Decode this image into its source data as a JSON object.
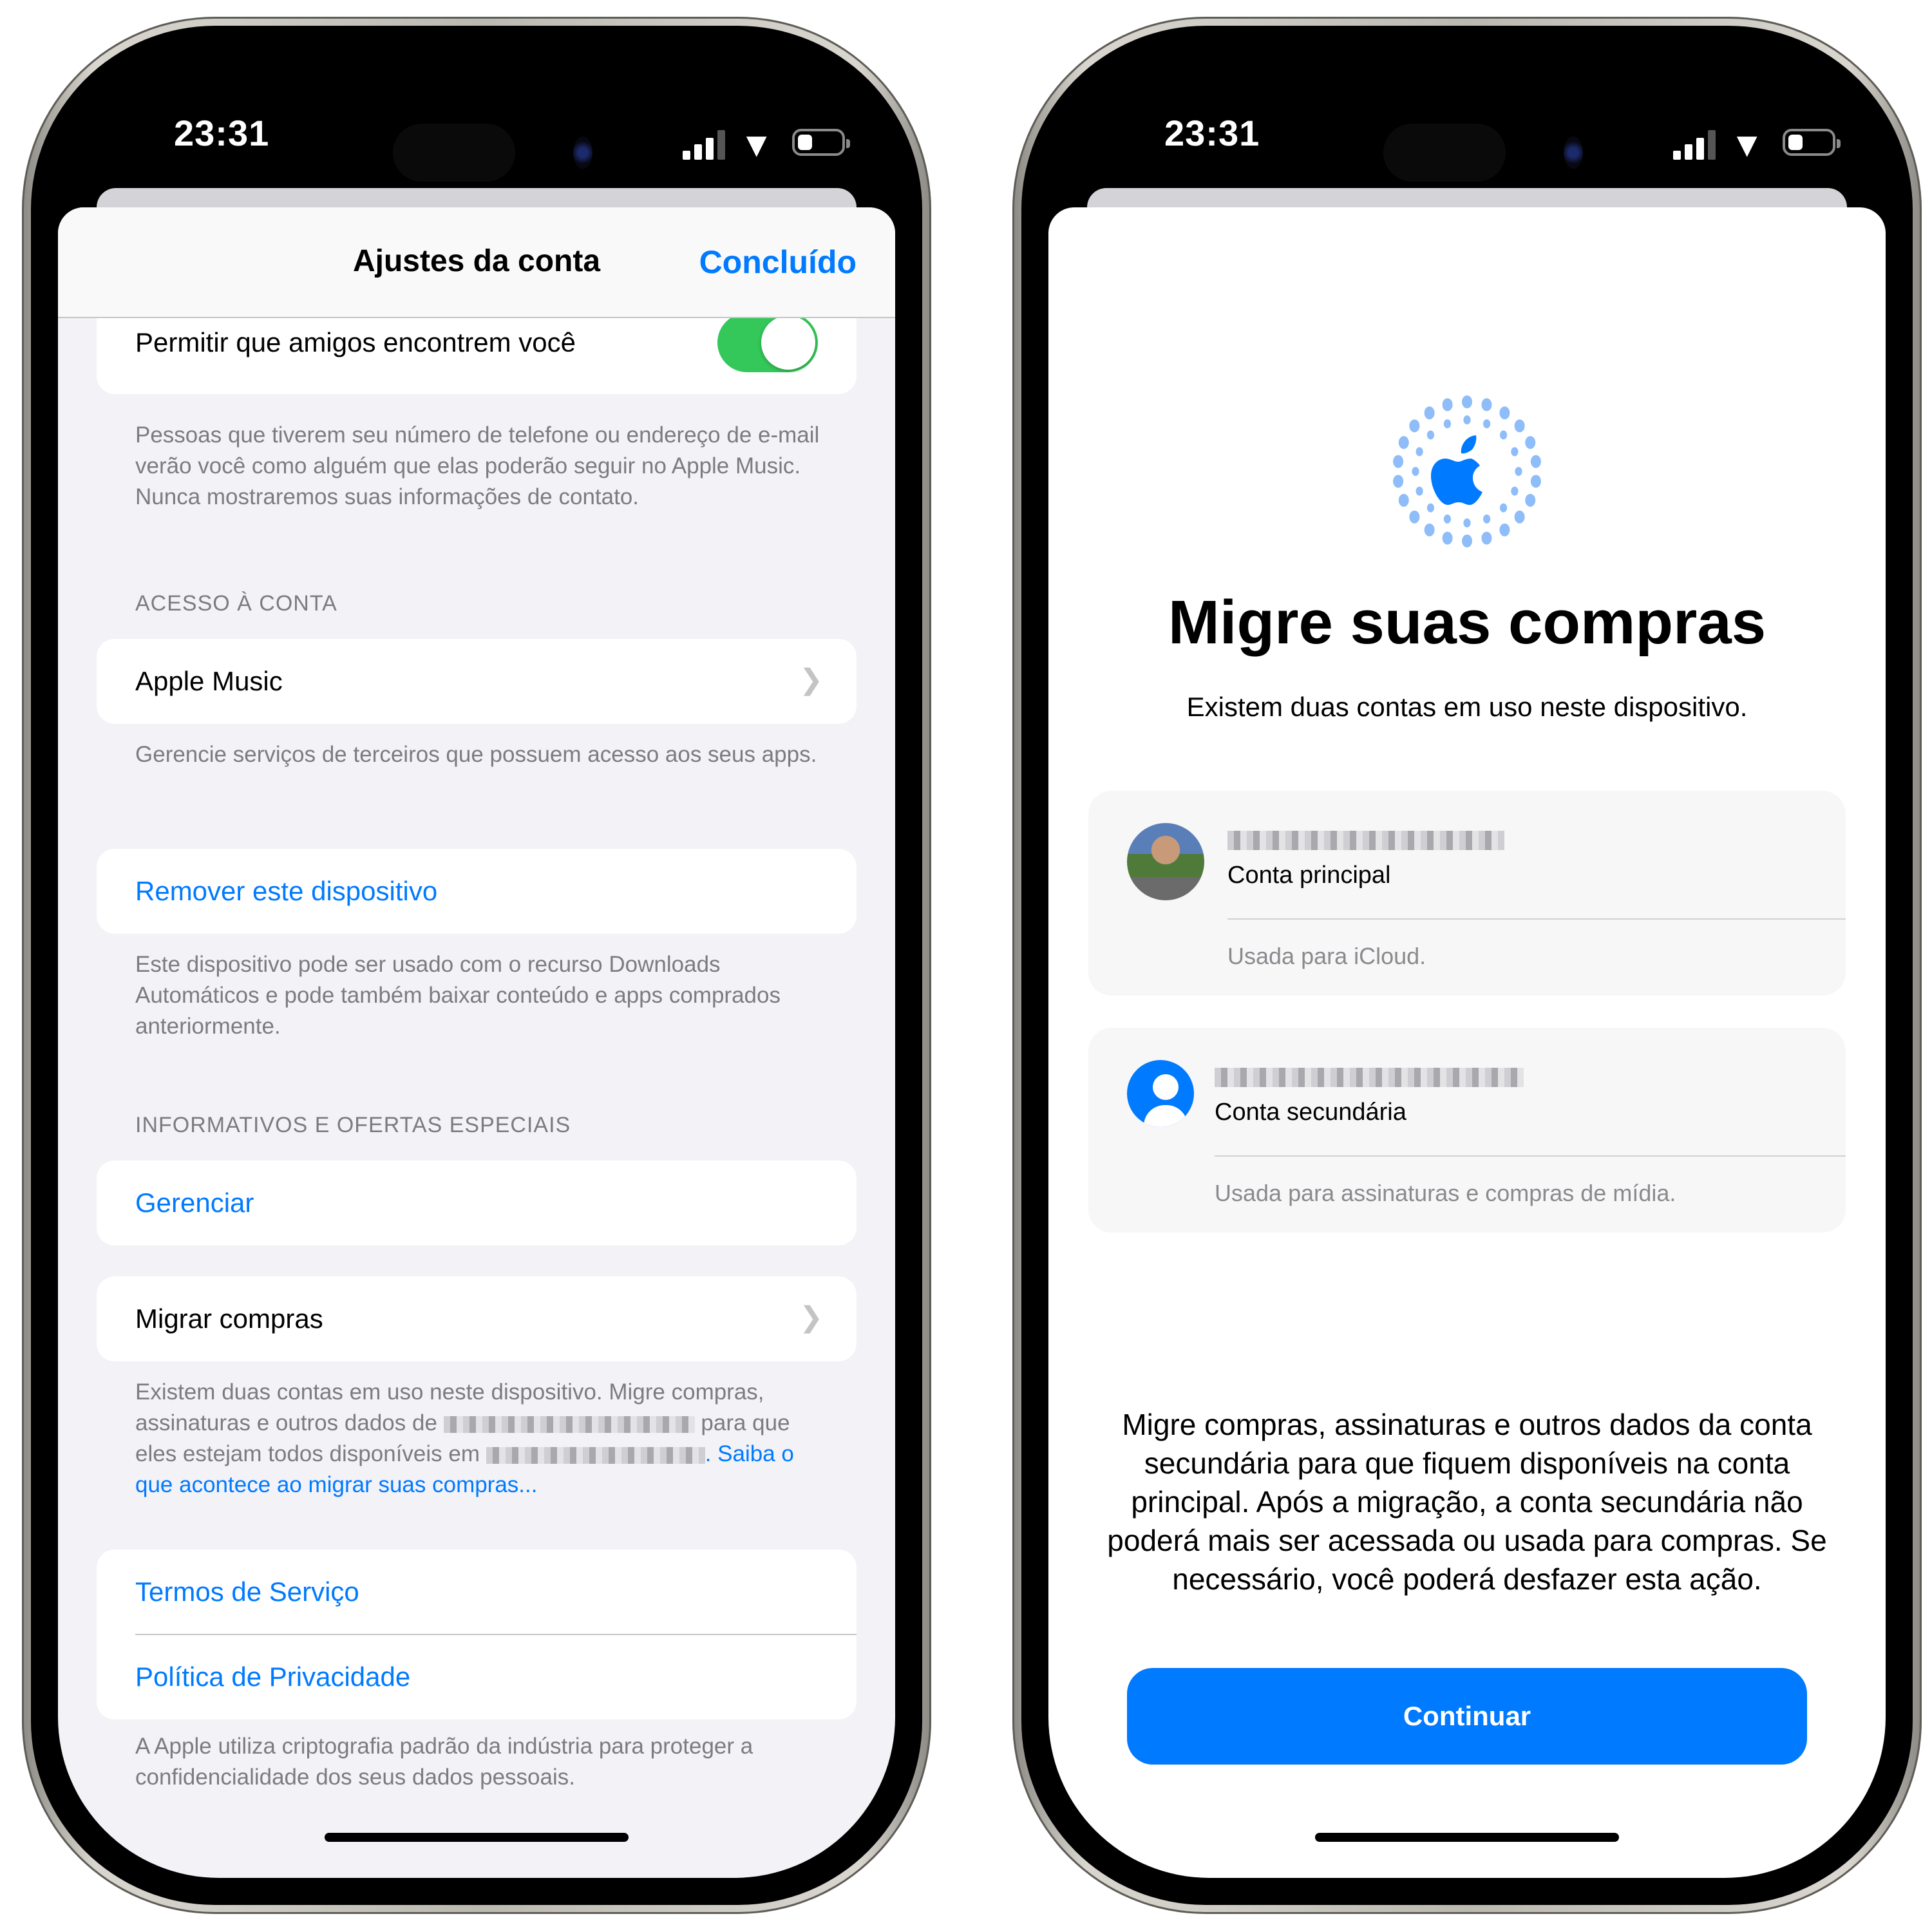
{
  "status_bar": {
    "time": "23:31"
  },
  "left_screen": {
    "nav": {
      "title": "Ajustes da conta",
      "done": "Concluído"
    },
    "friends_toggle": {
      "label": "Permitir que amigos encontrem você",
      "on": true
    },
    "friends_footer": "Pessoas que tiverem seu número de telefone ou endereço de e-mail verão você como alguém que elas poderão seguir no Apple Music. Nunca mostraremos suas informações de contato.",
    "access_header": "ACESSO À CONTA",
    "apple_music": "Apple Music",
    "access_footer": "Gerencie serviços de terceiros que possuem acesso aos seus apps.",
    "remove_device": "Remover este dispositivo",
    "remove_footer": "Este dispositivo pode ser usado com o recurso Downloads Automáticos e pode também baixar conteúdo e apps comprados anteriormente.",
    "offers_header": "INFORMATIVOS E OFERTAS ESPECIAIS",
    "manage": "Gerenciar",
    "migrate": "Migrar compras",
    "migrate_footer_1": "Existem duas contas em uso neste dispositivo. Migre compras, assinaturas e outros dados de",
    "migrate_footer_2": "para que eles estejam todos disponíveis em",
    "migrate_footer_link": ". Saiba o que acontece ao migrar suas compras...",
    "terms": "Termos de Serviço",
    "privacy": "Política de Privacidade",
    "privacy_footer": "A Apple utiliza criptografia padrão da indústria para proteger a confidencialidade dos seus dados pessoais."
  },
  "right_screen": {
    "title": "Migre suas compras",
    "subtitle": "Existem duas contas em uso neste dispositivo.",
    "accounts": [
      {
        "role": "Conta principal",
        "usage": "Usada para iCloud.",
        "email_redacted": true
      },
      {
        "role": "Conta secundária",
        "usage": "Usada para assinaturas e compras de mídia.",
        "email_redacted": true
      }
    ],
    "description": "Migre compras, assinaturas e outros dados da conta secundária para que fiquem disponíveis na conta principal. Após a migração, a conta secundária não poderá mais ser acessada ou usada para compras. Se necessário, você poderá desfazer esta ação.",
    "continue_button": "Continuar"
  },
  "colors": {
    "accent": "#007aff",
    "toggle_on": "#34c759",
    "grouped_bg": "#f2f2f7"
  }
}
